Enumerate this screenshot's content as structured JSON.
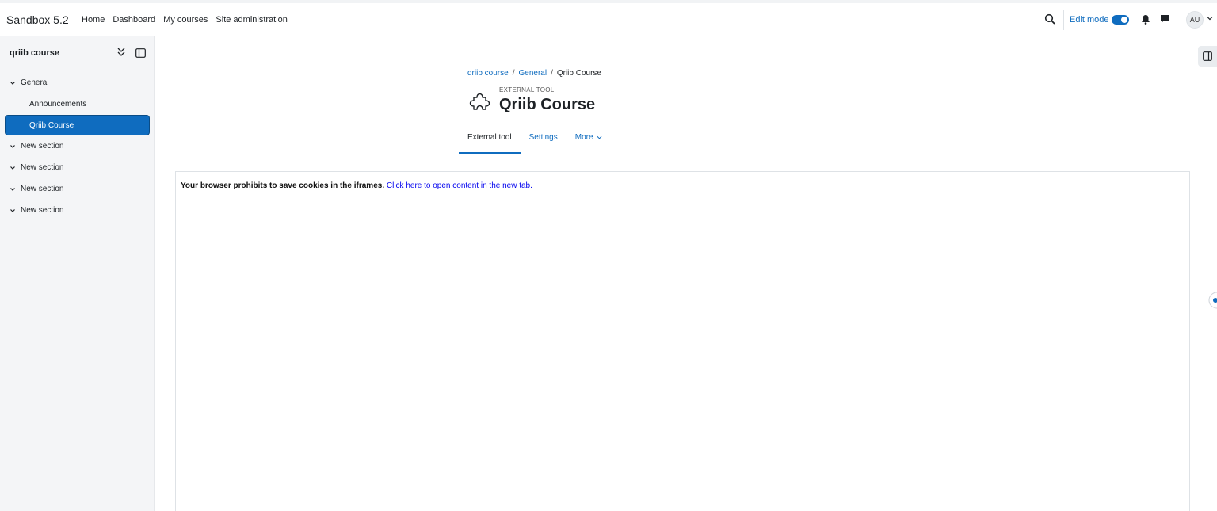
{
  "header": {
    "brand": "Sandbox 5.2",
    "nav": [
      "Home",
      "Dashboard",
      "My courses",
      "Site administration"
    ],
    "edit_mode_label": "Edit mode",
    "edit_mode_on": true,
    "avatar_initials": "AU"
  },
  "sidebar": {
    "title": "qriib course",
    "sections": [
      {
        "label": "General",
        "items": [
          "Announcements",
          "Qriib Course"
        ]
      },
      {
        "label": "New section"
      },
      {
        "label": "New section"
      },
      {
        "label": "New section"
      },
      {
        "label": "New section"
      }
    ],
    "active_item": "Qriib Course"
  },
  "breadcrumb": [
    "qriib course",
    "General",
    "Qriib Course"
  ],
  "activity": {
    "type_label": "EXTERNAL TOOL",
    "title": "Qriib Course",
    "icon": "puzzle-icon"
  },
  "tabs": [
    {
      "label": "External tool",
      "active": true
    },
    {
      "label": "Settings",
      "active": false
    },
    {
      "label": "More",
      "active": false
    }
  ],
  "frame": {
    "message_bold": "Your browser prohibits to save cookies in the iframes.",
    "message_link": "Click here to open content in the new tab."
  },
  "colors": {
    "accent": "#0f6cbf",
    "sidebar_bg": "#f4f5f7"
  }
}
